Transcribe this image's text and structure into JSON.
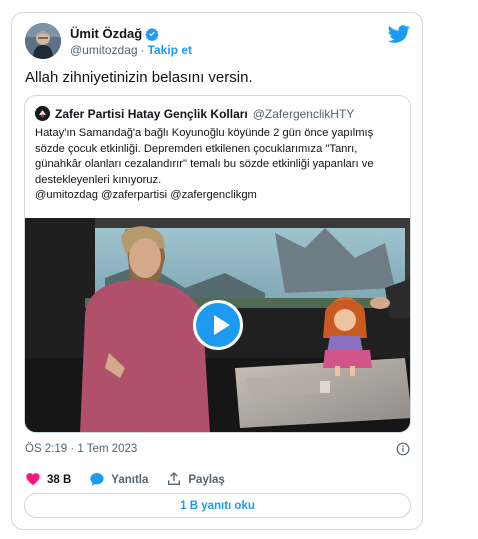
{
  "author": {
    "name": "Ümit Özdağ",
    "handle": "@umitozdag",
    "separator": "·",
    "follow_label": "Takip et"
  },
  "tweet": {
    "text": "Allah zihniyetinizin belasını versin."
  },
  "quoted": {
    "name": "Zafer Partisi Hatay Gençlik Kolları",
    "handle": "@ZafergenclikHTY",
    "paragraphs": [
      "Hatay'ın Samandağ'a bağlı Koyunoğlu köyünde 2 gün önce yapılmış sözde çocuk etkinliği. Depremden etkilenen çocuklarımıza  \"Tanrı, günahkâr olanları cezalandırır\" temalı bu sözde etkinliği yapanları ve destekleyenleri kınıyoruz.",
      "@umitozdag @zaferpartisi @zafergenclikgm"
    ]
  },
  "meta": {
    "timestamp": "ÖS 2:19 · 1 Tem 2023"
  },
  "actions": {
    "likes": "38 B",
    "reply_label": "Yanıtla",
    "share_label": "Paylaş"
  },
  "read_replies_label": "1 B yanıtı oku",
  "colors": {
    "accent": "#1d9bf0",
    "like": "#f91880",
    "border": "#cfd9de",
    "muted": "#536471"
  },
  "icons": [
    "verified-badge-icon",
    "twitter-bird-icon",
    "play-icon",
    "info-icon",
    "heart-icon",
    "reply-bubble-icon",
    "share-icon"
  ]
}
